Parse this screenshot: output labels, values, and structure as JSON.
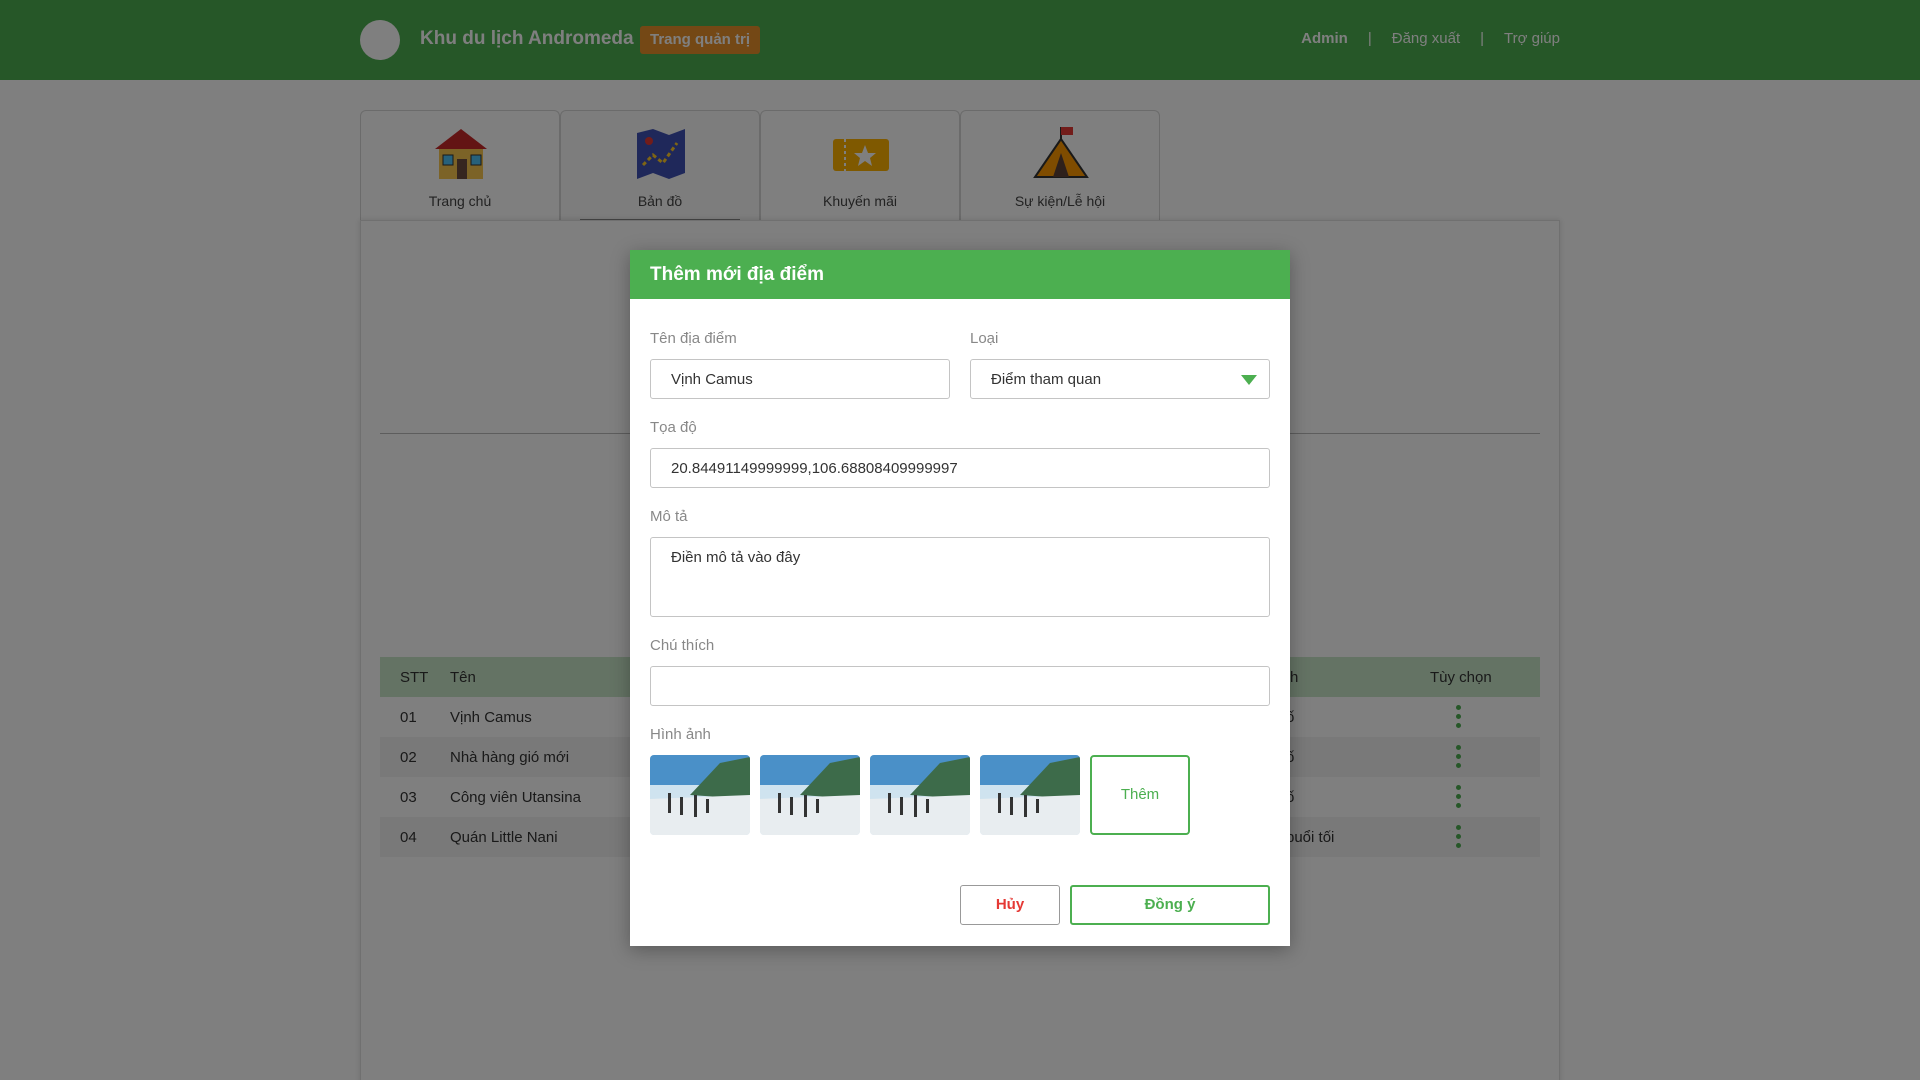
{
  "header": {
    "brand": "Khu du lịch Andromeda",
    "badge": "Trang quản trị",
    "nav": {
      "user": "Admin",
      "sep": "|",
      "logout": "Đăng xuất",
      "help": "Trợ giúp"
    }
  },
  "tabs": [
    {
      "label": "Trang chủ",
      "icon": "house-icon"
    },
    {
      "label": "Bản đồ",
      "icon": "map-icon"
    },
    {
      "label": "Khuyến mãi",
      "icon": "ticket-star-icon"
    },
    {
      "label": "Sự kiện/Lễ hội",
      "icon": "tent-flag-icon"
    }
  ],
  "table": {
    "headers": {
      "stt": "STT",
      "name": "Tên",
      "desc_partial": "h",
      "options": "Tùy chọn"
    },
    "rows": [
      {
        "stt": "01",
        "name": "Vịnh Camus",
        "desc_partial": "ố"
      },
      {
        "stt": "02",
        "name": "Nhà hàng gió mới",
        "desc_partial": "ố"
      },
      {
        "stt": "03",
        "name": "Công viên Utansina",
        "desc_partial": "ố"
      },
      {
        "stt": "04",
        "name": "Quán Little Nani",
        "desc_partial": "buổi tối"
      }
    ]
  },
  "modal": {
    "title": "Thêm mới địa điểm",
    "name_label": "Tên địa điểm",
    "name_value": "Vịnh Camus",
    "type_label": "Loại",
    "type_value": "Điểm tham quan",
    "coord_label": "Tọa độ",
    "coord_value": "20.84491149999999,106.68808409999997",
    "desc_label": "Mô tả",
    "desc_placeholder": "Điền mô tả vào đây",
    "note_label": "Chú thích",
    "note_value": "",
    "images_label": "Hình ảnh",
    "add_image": "Thêm",
    "cancel": "Hủy",
    "ok": "Đồng ý"
  },
  "colors": {
    "primary": "#4caf50",
    "badge": "#e8912a",
    "danger": "#e53935",
    "table_head": "#c8e6c9"
  }
}
